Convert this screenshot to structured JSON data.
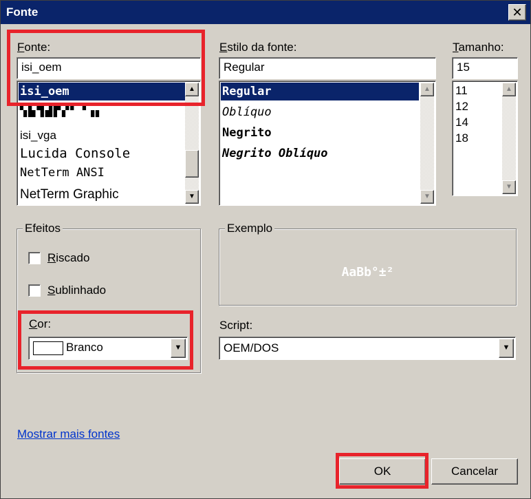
{
  "window": {
    "title": "Fonte",
    "close_glyph": "✕"
  },
  "font": {
    "label_ul": "F",
    "label_rest": "onte:",
    "input_value": "isi_oem",
    "list": [
      "isi_oem",
      "▚▙▜▟▛▞▘▝▗▖",
      "isi_vga",
      "Lucida Console",
      "NetTerm ANSI",
      "NetTerm Graphic"
    ],
    "selected_index": 0
  },
  "style": {
    "label_ul": "E",
    "label_rest": "stilo da fonte:",
    "input_value": "Regular",
    "list": [
      "Regular",
      "Oblíquo",
      "Negrito",
      "Negrito Oblíquo"
    ],
    "selected_index": 0
  },
  "size": {
    "label_ul": "T",
    "label_rest": "amanho:",
    "input_value": "15",
    "list": [
      "11",
      "12",
      "14",
      "18"
    ]
  },
  "effects": {
    "title": "Efeitos",
    "strike_ul": "R",
    "strike_rest": "iscado",
    "strike_checked": false,
    "underline_ul": "S",
    "underline_rest": "ublinhado",
    "underline_checked": false,
    "color_ul": "C",
    "color_rest": "or:",
    "color_value": "Branco",
    "color_swatch": "#ffffff"
  },
  "sample": {
    "title": "Exemplo",
    "text": "AaBb°±²"
  },
  "script": {
    "label": "Script:",
    "value": "OEM/DOS"
  },
  "more_fonts_link": "Mostrar mais fontes",
  "buttons": {
    "ok": "OK",
    "cancel": "Cancelar"
  },
  "colors": {
    "titlebar": "#0a246a",
    "selection": "#0a246a",
    "highlight_box": "#e8232b",
    "link": "#0033cc"
  }
}
